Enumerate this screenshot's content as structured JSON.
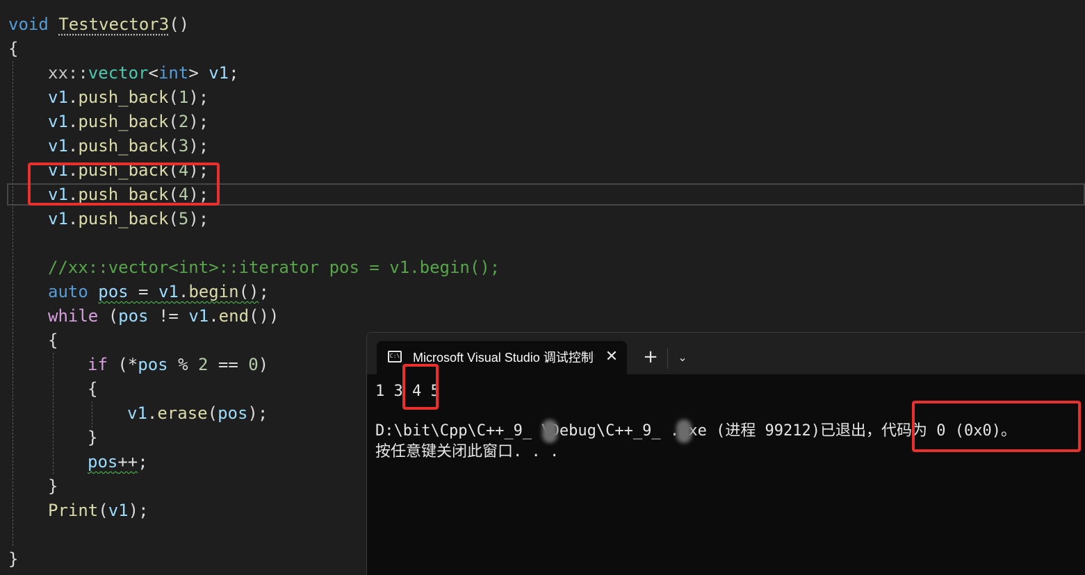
{
  "editor": {
    "func_kw": "void",
    "func_name": "Testvector3",
    "func_parens": "()",
    "open_brace": "{",
    "close_brace": "}",
    "decl_ns": "xx::",
    "decl_type": "vector",
    "decl_lt": "<",
    "decl_int": "int",
    "decl_gt": ">",
    "decl_var": "v1",
    "semicolon": ";",
    "v1": "v1",
    "push_dot": ".",
    "push_fn": "push_back",
    "push_args": [
      "1",
      "2",
      "3",
      "4",
      "4",
      "5"
    ],
    "comment": "//xx::vector<int>::iterator pos = v1.begin();",
    "auto_kw": "auto",
    "pos": "pos",
    "assign": " = ",
    "begin_fn": "begin",
    "while_kw": "while",
    "neq": " != ",
    "end_fn": "end",
    "if_kw": "if",
    "deref": "(*",
    "mod": " % ",
    "two": "2",
    "eqeq": " == ",
    "zero": "0",
    "erase_fn": "erase",
    "incr": "++",
    "print_fn": "Print"
  },
  "terminal": {
    "tab_title": "Microsoft Visual Studio 调试控制台",
    "tab_icon_text": "C:\\",
    "close_glyph": "✕",
    "new_tab_glyph": "+",
    "dropdown_glyph": "⌄",
    "output_line1": "1 3 4 5",
    "output_line2": "D:\\bit\\Cpp\\C++_9_ \\Debug\\C++_9_ .exe (进程 99212)已退出，代码为 0 (0x0)。",
    "output_line3": "按任意键关闭此窗口. . ."
  },
  "colors": {
    "annotation_red": "#e8302c",
    "editor_bg": "#1e1e1e",
    "terminal_bg": "#0c0c0c"
  }
}
